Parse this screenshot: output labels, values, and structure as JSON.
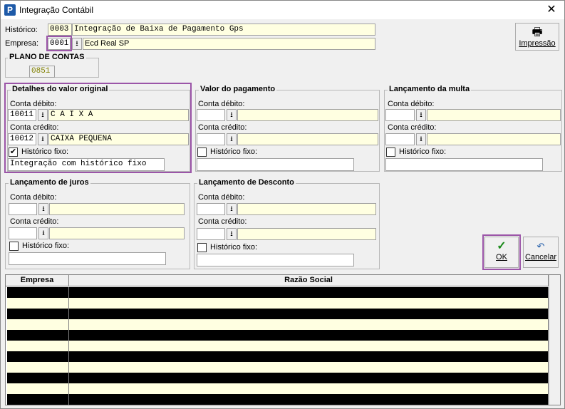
{
  "window": {
    "title": "Integração Contábil",
    "close": "✕",
    "app_icon": "P"
  },
  "header": {
    "historico_label": "Histórico:",
    "historico_code": "0003",
    "historico_value": "Integração de Baixa de Pagamento Gps",
    "empresa_label": "Empresa:",
    "empresa_code": "0001",
    "empresa_value": "Ecd Real SP"
  },
  "plano_contas": {
    "title": "PLANO DE CONTAS",
    "value": "0851"
  },
  "toolbar": {
    "print_label": "Impressão",
    "print_icon": "printer-icon",
    "ok_label": "OK",
    "cancel_label": "Cancelar"
  },
  "groups": {
    "valor_original": {
      "title": "Detalhes do valor original",
      "debito_label": "Conta débito:",
      "debito_code": "10011",
      "debito_value": "C A I X A",
      "credito_label": "Conta crédito:",
      "credito_code": "10012",
      "credito_value": "CAIXA PEQUENA",
      "historico_label": "Histórico fixo:",
      "historico_checked": "✔",
      "historico_value": "Integração com histórico fixo"
    },
    "valor_pagamento": {
      "title": "Valor do pagamento",
      "debito_label": "Conta débito:",
      "credito_label": "Conta crédito:",
      "historico_label": "Histórico fixo:"
    },
    "lancamento_multa": {
      "title": "Lançamento da multa",
      "debito_label": "Conta débito:",
      "credito_label": "Conta crédito:",
      "historico_label": "Histórico fixo:"
    },
    "lancamento_juros": {
      "title": "Lançamento de juros",
      "debito_label": "Conta débito:",
      "credito_label": "Conta crédito:",
      "historico_label": "Histórico fixo:"
    },
    "lancamento_desconto": {
      "title": "Lançamento de Desconto",
      "debito_label": "Conta débito:",
      "credito_label": "Conta crédito:",
      "historico_label": "Histórico fixo:"
    }
  },
  "table": {
    "columns": [
      "Empresa",
      "Razão Social"
    ],
    "row_count": 10
  },
  "colors": {
    "highlight": "#9b55a8",
    "field_bg": "#ffffe1",
    "ok_check": "#1a8a1a"
  }
}
